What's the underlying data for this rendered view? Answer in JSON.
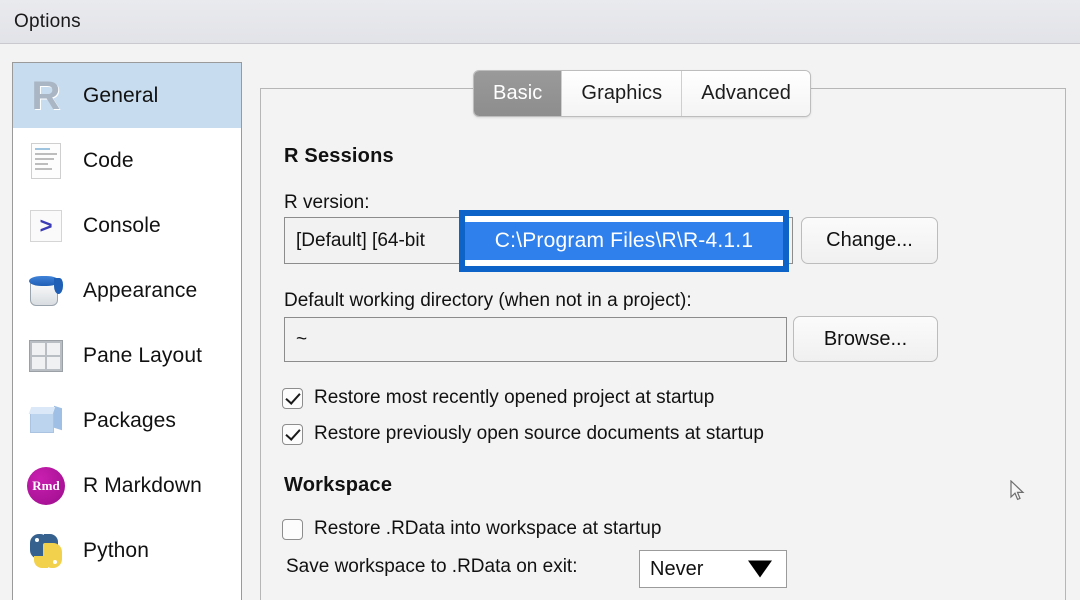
{
  "window": {
    "title": "Options"
  },
  "sidebar": {
    "items": [
      {
        "label": "General",
        "icon": "r-logo-icon",
        "selected": true
      },
      {
        "label": "Code",
        "icon": "document-icon",
        "selected": false
      },
      {
        "label": "Console",
        "icon": "prompt-icon",
        "selected": false
      },
      {
        "label": "Appearance",
        "icon": "paint-bucket-icon",
        "selected": false
      },
      {
        "label": "Pane Layout",
        "icon": "panes-icon",
        "selected": false
      },
      {
        "label": "Packages",
        "icon": "cube-icon",
        "selected": false
      },
      {
        "label": "R Markdown",
        "icon": "rmd-icon",
        "selected": false
      },
      {
        "label": "Python",
        "icon": "python-icon",
        "selected": false
      }
    ]
  },
  "tabs": [
    {
      "label": "Basic",
      "active": true
    },
    {
      "label": "Graphics",
      "active": false
    },
    {
      "label": "Advanced",
      "active": false
    }
  ],
  "main": {
    "sections": {
      "r_sessions_title": "R Sessions",
      "workspace_title": "Workspace"
    },
    "r_version": {
      "label": "R version:",
      "value": "[Default] [64-bit",
      "change_button": "Change..."
    },
    "working_directory": {
      "label": "Default working directory (when not in a project):",
      "value": "~",
      "browse_button": "Browse..."
    },
    "checkboxes": [
      {
        "label": "Restore most recently opened project at startup",
        "checked": true
      },
      {
        "label": "Restore previously open source documents at startup",
        "checked": true
      },
      {
        "label": "Restore .RData into workspace at startup",
        "checked": false
      }
    ],
    "save_workspace": {
      "label": "Save workspace to .RData on exit:",
      "value": "Never"
    }
  },
  "annotation": {
    "highlighted_path": "C:\\Program Files\\R\\R-4.1.1",
    "border_color": "#0e63c8",
    "selection_color": "#2f80ed"
  },
  "icons": {
    "rmd_text": "Rmd",
    "console_glyph": ">",
    "r_glyph": "R",
    "cursor": "mouse-pointer-icon"
  }
}
